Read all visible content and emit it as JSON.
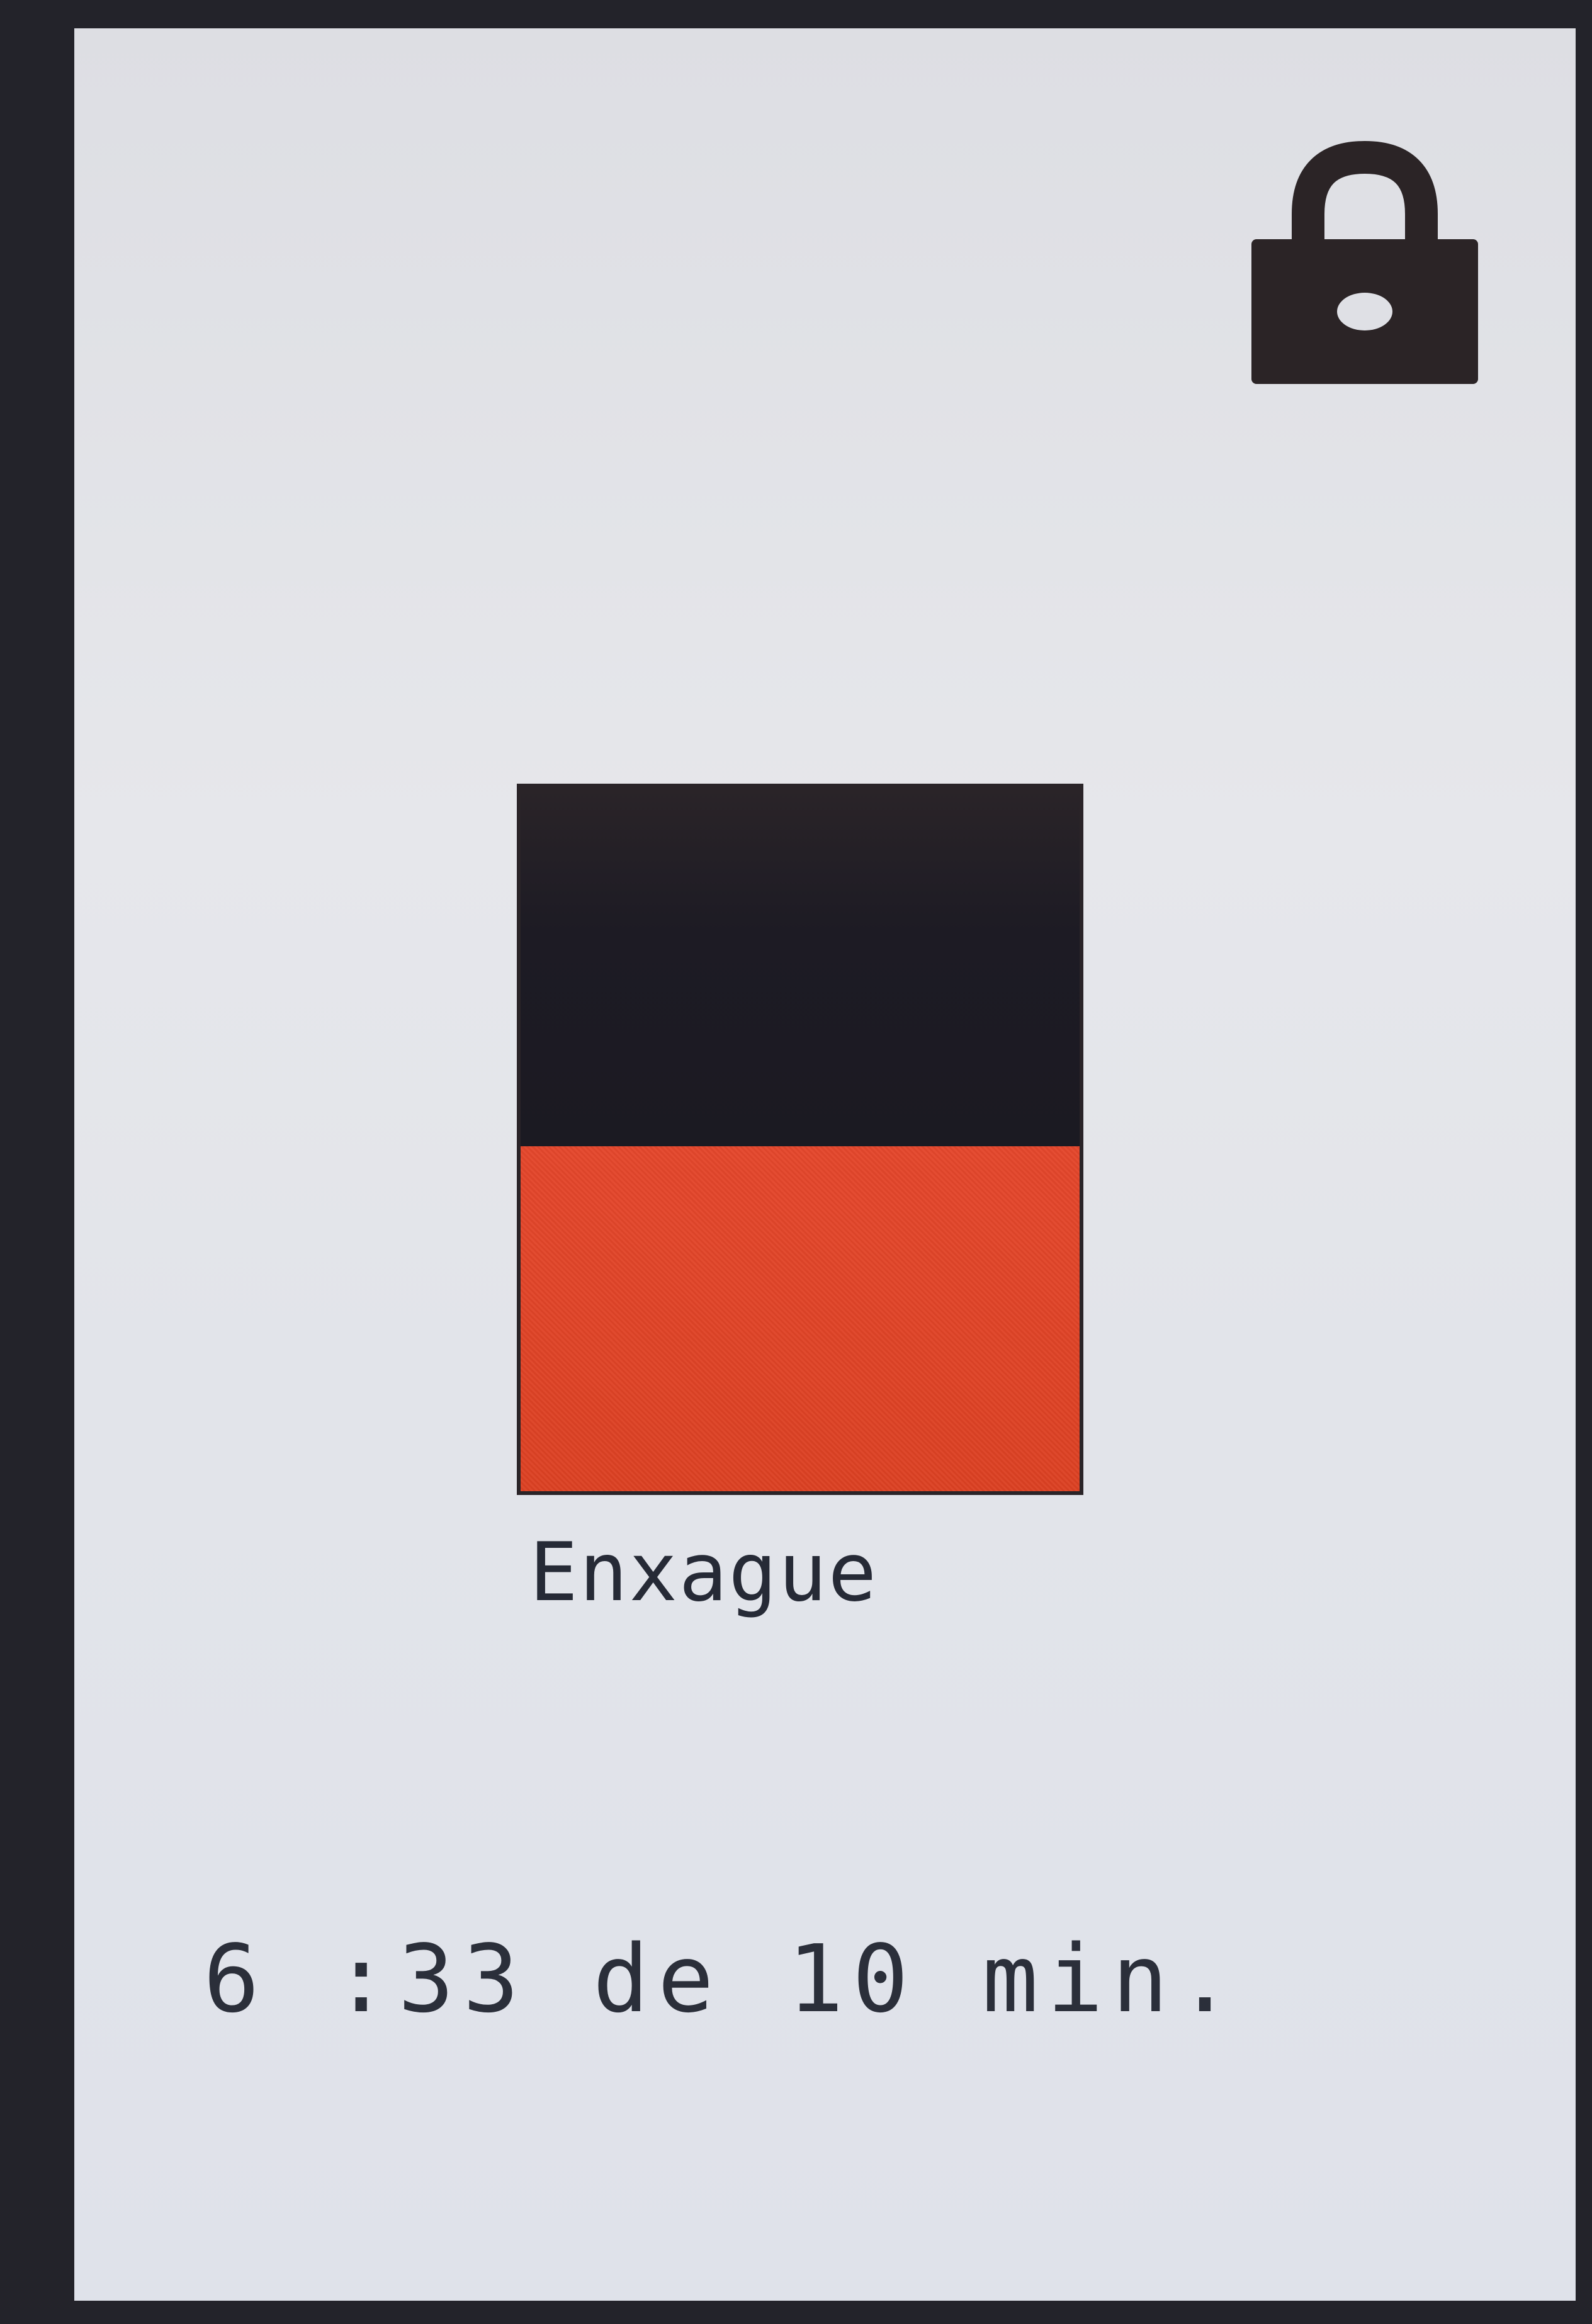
{
  "status": {
    "locked": true,
    "lock_icon": "lock-icon"
  },
  "cycle": {
    "phase_label": "Enxague",
    "progress_fraction": 0.49,
    "fill_color": "#df4326",
    "empty_color": "#1d1b24"
  },
  "timer": {
    "text": "6 :33 de 10 min."
  }
}
